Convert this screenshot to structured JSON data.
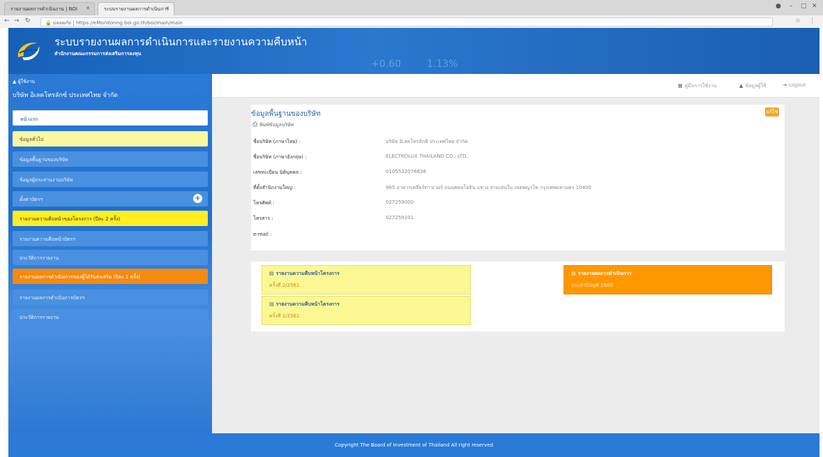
{
  "browser": {
    "tabs": [
      {
        "label": "รายงานผลการดำเนินงาน | BOI"
      },
      {
        "label": "ระบบรายงานผลการดำเนินการ"
      }
    ],
    "url": "https://eMonitoring.boi.go.th/boi/main/main",
    "secure_label": "ปลอดภัย",
    "window_controls": {
      "user": "●",
      "minimize": "–",
      "maximize": "□",
      "close": "✕"
    }
  },
  "header": {
    "title": "ระบบรายงานผลการดำเนินการและรายงานความคืบหน้า",
    "subtitle": "สำนักงานคณะกรรมการส่งเสริมการลงทุน",
    "bg_numbers": [
      "+0.60",
      "1.13%"
    ]
  },
  "sidebar": {
    "user_role": "ผู้ใช้งาน",
    "company": "บริษัท อิเลคโทรลักซ์ ประเทศไทย จำกัด",
    "items": [
      {
        "label": "หน้าแรก",
        "style": "white"
      },
      {
        "label": "ข้อมูลทั่วไป",
        "style": "yellow"
      },
      {
        "label": "ข้อมูลพื้นฐานของบริษัท",
        "style": "blue"
      },
      {
        "label": "ข้อมูลผู้ประสานงานบริษัท",
        "style": "blue"
      },
      {
        "label": "ตั้งค่าบัตรฯ",
        "style": "blue",
        "plus": true
      },
      {
        "label": "รายงานความคืบหน้าของโครงการ (ปีละ 2 ครั้ง)",
        "style": "yellow-strong"
      },
      {
        "label": "รายงานความคืบหน้าบัตรฯ",
        "style": "blue"
      },
      {
        "label": "ประวัติการรายงาน",
        "style": "blue"
      },
      {
        "label": "รายงานผลการดำเนินการของผู้ได้รับส่งเสริม (ปีละ 1 ครั้ง)",
        "style": "orange"
      },
      {
        "label": "รายงานผลการดำเนินการบัตรฯ",
        "style": "blue"
      },
      {
        "label": "ประวัติการรายงาน",
        "style": "blue"
      }
    ]
  },
  "topbar": {
    "links": [
      {
        "icon": "▦",
        "label": "คู่มือการใช้งาน"
      },
      {
        "icon": "▲",
        "label": "ข้อมูลผู้ใช้"
      },
      {
        "icon": "⇥",
        "label": "Logout"
      }
    ]
  },
  "company_panel": {
    "title": "ข้อมูลพื้นฐานของบริษัท",
    "edit_label": "แก้ไข",
    "print_label": "พิมพ์ข้อมูลบริษัท",
    "rows": [
      {
        "label": "ชื่อบริษัท (ภาษาไทย) :",
        "value": "บริษัท อิเลคโทรลักซ์ ประเทศไทย จำกัด"
      },
      {
        "label": "ชื่อบริษัท (ภาษาอังกฤษ) :",
        "value": "ELECTROLUX THAILAND CO., LTD."
      },
      {
        "label": "เลขทะเบียน นิติบุคคล :",
        "value": "0105532076638"
      },
      {
        "label": "ที่ตั้งสำนักงานใหญ่ :",
        "value": "965 อาคารเคลียร์ทาวเวอร์ ถนนพหลโยธิน แขวง สามเสนใน เขตพญาไท กรุงเทพมหานคร 10400"
      },
      {
        "label": "โทรศัพท์ :",
        "value": "027259000"
      },
      {
        "label": "โทรสาร :",
        "value": "027259101"
      },
      {
        "label": "e-mail :",
        "value": ""
      }
    ]
  },
  "report_cards": [
    {
      "title": "รายงานความคืบหน้าโครงการ",
      "sub": "ครั้งที่ 2/2561",
      "style": "yellow"
    },
    {
      "title": "รายงานความคืบหน้าโครงการ",
      "sub": "ครั้งที่ 1/2561",
      "style": "yellow"
    },
    {
      "title": "รายงานผลการดำเนินการ",
      "sub": "ประจำปีบัญชี 2560",
      "style": "orange"
    }
  ],
  "footer": {
    "text": "Copyright The Board of Investment of Thailand All right reserved"
  }
}
